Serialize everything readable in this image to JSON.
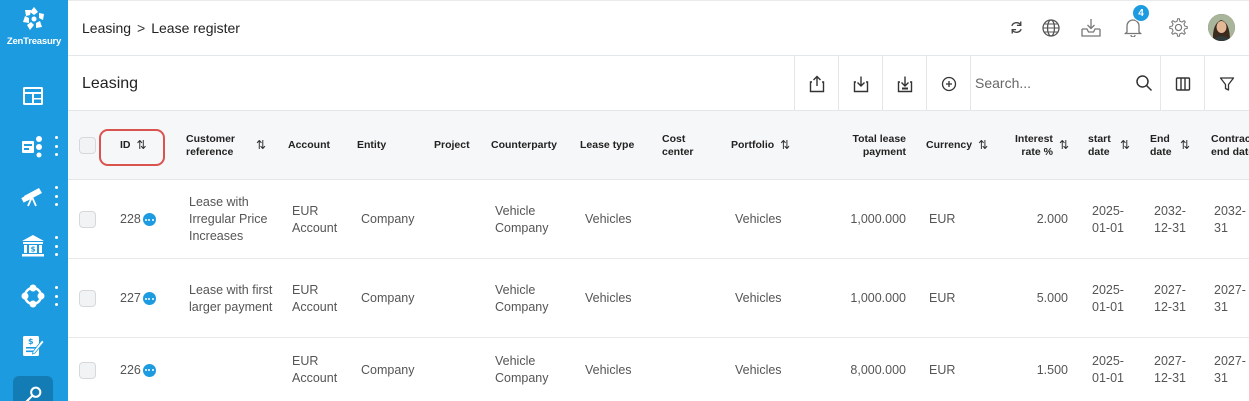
{
  "app": {
    "logo_text": "ZenTreasury"
  },
  "breadcrumb": {
    "parent": "Leasing",
    "separator": ">",
    "current": "Lease register"
  },
  "header": {
    "notification_count": "4"
  },
  "toolbar": {
    "title": "Leasing",
    "search_placeholder": "Search..."
  },
  "table": {
    "columns": [
      {
        "key": "id",
        "label": "ID",
        "sortable": true
      },
      {
        "key": "customer_reference",
        "label": "Customer reference",
        "sortable": true
      },
      {
        "key": "account",
        "label": "Account",
        "sortable": false
      },
      {
        "key": "entity",
        "label": "Entity",
        "sortable": false
      },
      {
        "key": "project",
        "label": "Project",
        "sortable": false
      },
      {
        "key": "counterparty",
        "label": "Counterparty",
        "sortable": false
      },
      {
        "key": "lease_type",
        "label": "Lease type",
        "sortable": false
      },
      {
        "key": "cost_center",
        "label": "Cost center",
        "sortable": false
      },
      {
        "key": "portfolio",
        "label": "Portfolio",
        "sortable": true
      },
      {
        "key": "total_lease_payment",
        "label": "Total lease payment",
        "sortable": false
      },
      {
        "key": "currency",
        "label": "Currency",
        "sortable": true
      },
      {
        "key": "interest_rate",
        "label": "Interest rate %",
        "sortable": true
      },
      {
        "key": "start_date",
        "label": "start date",
        "sortable": true
      },
      {
        "key": "end_date",
        "label": "End date",
        "sortable": true
      },
      {
        "key": "contract_end_date",
        "label": "Contract end date",
        "sortable": false
      }
    ],
    "rows": [
      {
        "id": "228",
        "customer_reference": "Lease with Irregular Price Increases",
        "account": "EUR Account",
        "entity": "Company",
        "project": "",
        "counterparty": "Vehicle Company",
        "lease_type": "Vehicles",
        "cost_center": "",
        "portfolio": "Vehicles",
        "total_lease_payment": "1,000.000",
        "currency": "EUR",
        "interest_rate": "2.000",
        "start_date": "2025-01-01",
        "end_date": "2032-12-31",
        "contract_end_date": "2032-31"
      },
      {
        "id": "227",
        "customer_reference": "Lease with first larger payment",
        "account": "EUR Account",
        "entity": "Company",
        "project": "",
        "counterparty": "Vehicle Company",
        "lease_type": "Vehicles",
        "cost_center": "",
        "portfolio": "Vehicles",
        "total_lease_payment": "1,000.000",
        "currency": "EUR",
        "interest_rate": "5.000",
        "start_date": "2025-01-01",
        "end_date": "2027-12-31",
        "contract_end_date": "2027-31"
      },
      {
        "id": "226",
        "customer_reference": "",
        "account": "EUR Account",
        "entity": "Company",
        "project": "",
        "counterparty": "Vehicle Company",
        "lease_type": "Vehicles",
        "cost_center": "",
        "portfolio": "Vehicles",
        "total_lease_payment": "8,000.000",
        "currency": "EUR",
        "interest_rate": "1.500",
        "start_date": "2025-01-01",
        "end_date": "2027-12-31",
        "contract_end_date": "2027-31"
      }
    ]
  },
  "colors": {
    "sidebar": "#1d9be0",
    "accent": "#1d9be0",
    "highlight": "#d9534f"
  }
}
